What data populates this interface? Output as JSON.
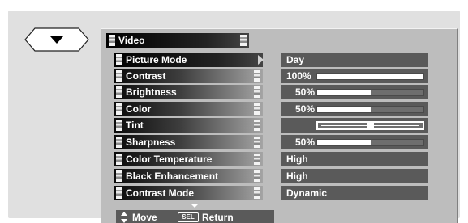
{
  "header": {
    "title": "Video"
  },
  "menu": [
    {
      "label": "Picture Mode",
      "value": "Day",
      "selected": true
    },
    {
      "label": "Contrast",
      "value": "100%",
      "level": 100
    },
    {
      "label": "Brightness",
      "value": "50%",
      "level": 50
    },
    {
      "label": "Color",
      "value": "50%",
      "level": 50
    },
    {
      "label": "Tint",
      "value": "",
      "tint_level": 50
    },
    {
      "label": "Sharpness",
      "value": "50%",
      "level": 50
    },
    {
      "label": "Color Temperature",
      "value": "High"
    },
    {
      "label": "Black Enhancement",
      "value": "High"
    },
    {
      "label": "Contrast Mode",
      "value": "Dynamic"
    }
  ],
  "footer": {
    "move_label": "Move",
    "sel_key": "SEL",
    "return_label": "Return"
  },
  "icons": [
    "scroll-down-icon",
    "more-below-icon",
    "up-down-arrows-icon",
    "sel-key-icon",
    "submenu-arrow-icon"
  ]
}
